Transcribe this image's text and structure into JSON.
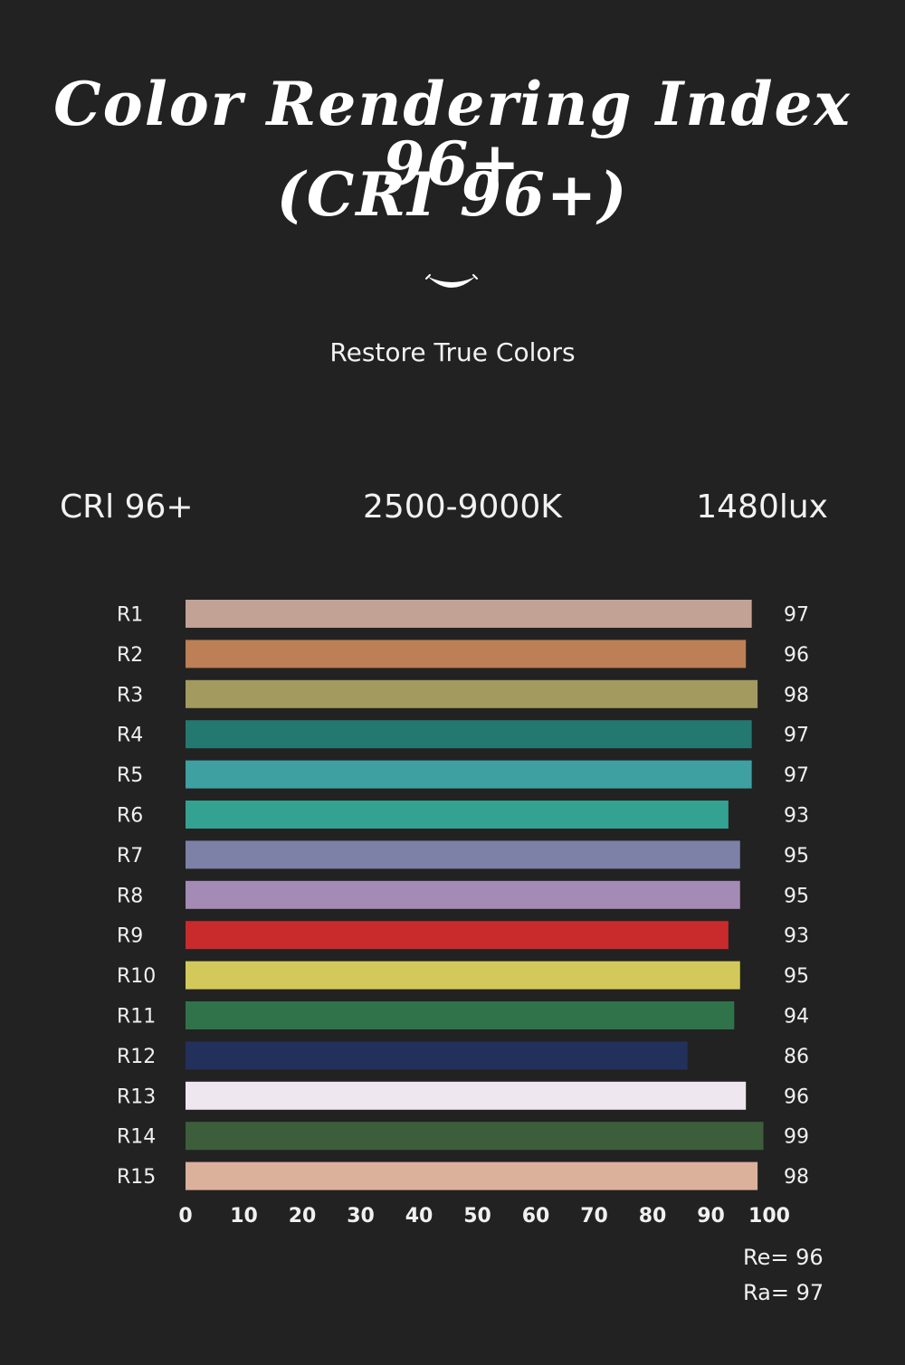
{
  "header": {
    "title_line1": "Color Rendering Index 96+",
    "title_line2": "(CRI 96+)",
    "subtitle": "Restore True Colors"
  },
  "specs": {
    "cri": "CRl 96+",
    "cct": "2500-9000K",
    "lux": "1480lux"
  },
  "chart_data": {
    "type": "bar",
    "orientation": "horizontal",
    "categories": [
      "R1",
      "R2",
      "R3",
      "R4",
      "R5",
      "R6",
      "R7",
      "R8",
      "R9",
      "R10",
      "R11",
      "R12",
      "R13",
      "R14",
      "R15"
    ],
    "values": [
      97,
      96,
      98,
      97,
      97,
      93,
      95,
      95,
      93,
      95,
      94,
      86,
      96,
      99,
      98
    ],
    "colors": [
      "#c2a294",
      "#bc7f56",
      "#a29a5e",
      "#237970",
      "#3fa0a2",
      "#34a291",
      "#7d81a8",
      "#a48bb6",
      "#c92a2b",
      "#d3c95a",
      "#30734a",
      "#22305c",
      "#efe7ef",
      "#3c5e3a",
      "#dcb19b"
    ],
    "xticks": [
      0,
      10,
      20,
      30,
      40,
      50,
      60,
      70,
      80,
      90,
      100
    ],
    "xlim": [
      0,
      100
    ],
    "grid": false,
    "annotations": [
      "Re= 96",
      "Ra= 97"
    ]
  },
  "colors": {
    "background": "#222222",
    "text": "#ffffff"
  }
}
